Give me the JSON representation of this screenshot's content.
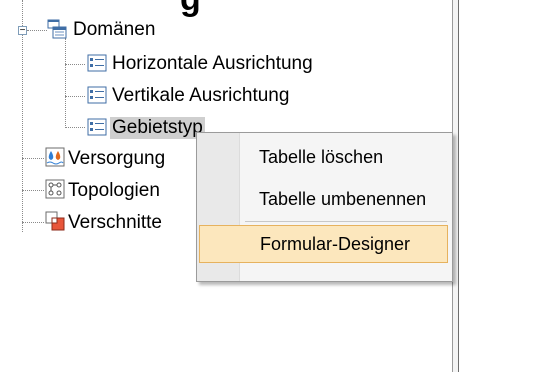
{
  "tree": {
    "domains": {
      "label": "Domänen",
      "icon": "table-group-icon"
    },
    "domain_items": [
      {
        "label": "Horizontale Ausrichtung",
        "icon": "table-icon"
      },
      {
        "label": "Vertikale Ausrichtung",
        "icon": "table-icon"
      },
      {
        "label": "Gebietstyp",
        "icon": "table-icon",
        "selected": true
      }
    ],
    "others": [
      {
        "label": "Versorgung",
        "icon": "utility-network-icon"
      },
      {
        "label": "Topologien",
        "icon": "topology-icon"
      },
      {
        "label": "Verschnitte",
        "icon": "overlay-icon"
      }
    ]
  },
  "context_menu": {
    "items": [
      {
        "label": "Tabelle löschen"
      },
      {
        "label": "Tabelle umbenennen"
      },
      {
        "label": "Formular-Designer",
        "highlighted": true
      }
    ]
  },
  "colors": {
    "highlight_bg": "#fce7bd",
    "highlight_border": "#e6b25e",
    "selected_bg": "#cfcfcf"
  }
}
